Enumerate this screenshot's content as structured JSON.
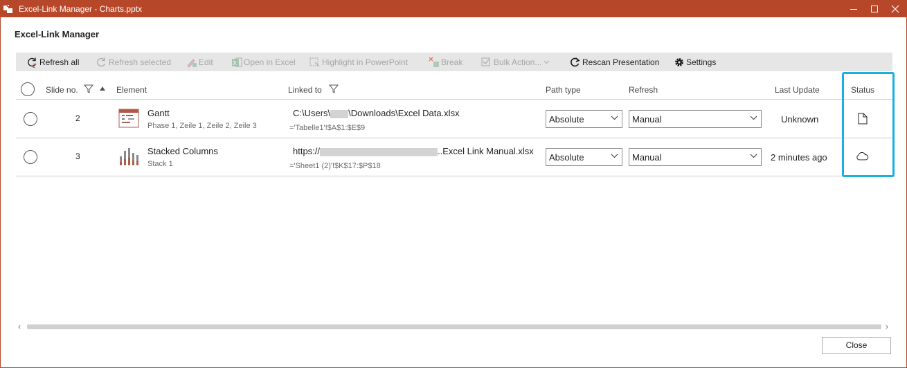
{
  "window": {
    "title": "Excel-Link Manager - Charts.pptx"
  },
  "heading": "Excel-Link Manager",
  "toolbar": {
    "refresh_all": "Refresh all",
    "refresh_selected": "Refresh selected",
    "edit": "Edit",
    "open_in_excel": "Open in Excel",
    "highlight": "Highlight in PowerPoint",
    "break": "Break",
    "bulk_action": "Bulk Action...",
    "rescan": "Rescan Presentation",
    "settings": "Settings"
  },
  "columns": {
    "slide_no": "Slide no.",
    "element": "Element",
    "linked_to": "Linked to",
    "path_type": "Path type",
    "refresh": "Refresh",
    "last_update": "Last Update",
    "status": "Status"
  },
  "rows": [
    {
      "slide": "2",
      "element": "Gantt",
      "element_sub": "Phase 1, Zeile 1, Zeile 2, Zeile 3",
      "link_prefix": "C:\\Users\\",
      "link_suffix": "\\Downloads\\Excel Data.xlsx",
      "link_range": "='Tabelle1'!$A$1:$E$9",
      "path_type": "Absolute",
      "refresh": "Manual",
      "last_update": "Unknown",
      "status_icon": "file-icon"
    },
    {
      "slide": "3",
      "element": "Stacked Columns",
      "element_sub": "Stack 1",
      "link_prefix": "https://",
      "link_suffix": "..Excel Link Manual.xlsx",
      "link_range": "='Sheet1 (2)'!$K$17:$P$18",
      "path_type": "Absolute",
      "refresh": "Manual",
      "last_update": "2 minutes ago",
      "status_icon": "cloud-icon"
    }
  ],
  "footer": {
    "close": "Close"
  },
  "colors": {
    "titlebar": "#b8472a",
    "highlight": "#1ab0e0",
    "refresh_badge": "#c0392b"
  }
}
